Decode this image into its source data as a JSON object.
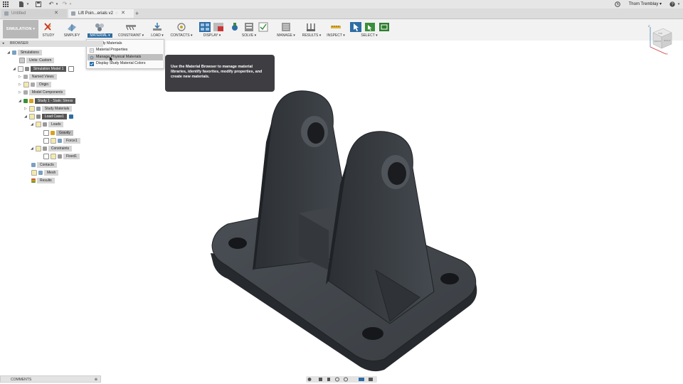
{
  "topbar": {
    "user_name": "Thom Tremblay ▾"
  },
  "tabs": [
    {
      "label": "Untitled",
      "active": false
    },
    {
      "label": "Lift Poin...erials v2",
      "active": true
    }
  ],
  "toolbar": {
    "workspace": "SIMULATION ▾",
    "groups": [
      {
        "label": "STUDY"
      },
      {
        "label": "SIMPLIFY"
      },
      {
        "label": "MATERIAL ▾"
      },
      {
        "label": "CONSTRAINT ▾"
      },
      {
        "label": "LOAD ▾"
      },
      {
        "label": "CONTACTS ▾"
      },
      {
        "label": "DISPLAY ▾"
      },
      {
        "label": "SOLVE ▾"
      },
      {
        "label": "MANAGE ▾"
      },
      {
        "label": "RESULTS ▾"
      },
      {
        "label": "INSPECT ▾"
      },
      {
        "label": "SELECT ▾"
      }
    ]
  },
  "material_menu": {
    "items": [
      {
        "label": "Study Materials"
      },
      {
        "label": "Material Properties"
      },
      {
        "label": "Manage Physical Materials"
      },
      {
        "label": "Display Study Material Colors"
      }
    ]
  },
  "tooltip": {
    "text": "Use the Material Browser to manage material libraries, identify favorites, modify properties, and create new materials."
  },
  "browser": {
    "header": "BROWSER",
    "nodes": [
      {
        "label": "Simulations"
      },
      {
        "label": "Units: Custom"
      },
      {
        "label": "Simulation Model 1"
      },
      {
        "label": "Named Views"
      },
      {
        "label": "Origin"
      },
      {
        "label": "Model Components"
      },
      {
        "label": "Study 1 - Static Stress"
      },
      {
        "label": "Study Materials"
      },
      {
        "label": "Load Case1"
      },
      {
        "label": "Loads"
      },
      {
        "label": "Gravity"
      },
      {
        "label": "Force1"
      },
      {
        "label": "Constraints"
      },
      {
        "label": "Fixed1"
      },
      {
        "label": "Contacts"
      },
      {
        "label": "Mesh"
      },
      {
        "label": "Results"
      }
    ]
  },
  "comments": {
    "label": "COMMENTS"
  },
  "viewcube": {
    "top": "TOP",
    "front": "FRONT",
    "right": "RIGHT",
    "axis_z": "Z",
    "axis_x": "X"
  },
  "colors": {
    "tooltip_bg": "#3e3e42",
    "part": "#3b3f44",
    "accent_blue": "#2e6da4"
  }
}
